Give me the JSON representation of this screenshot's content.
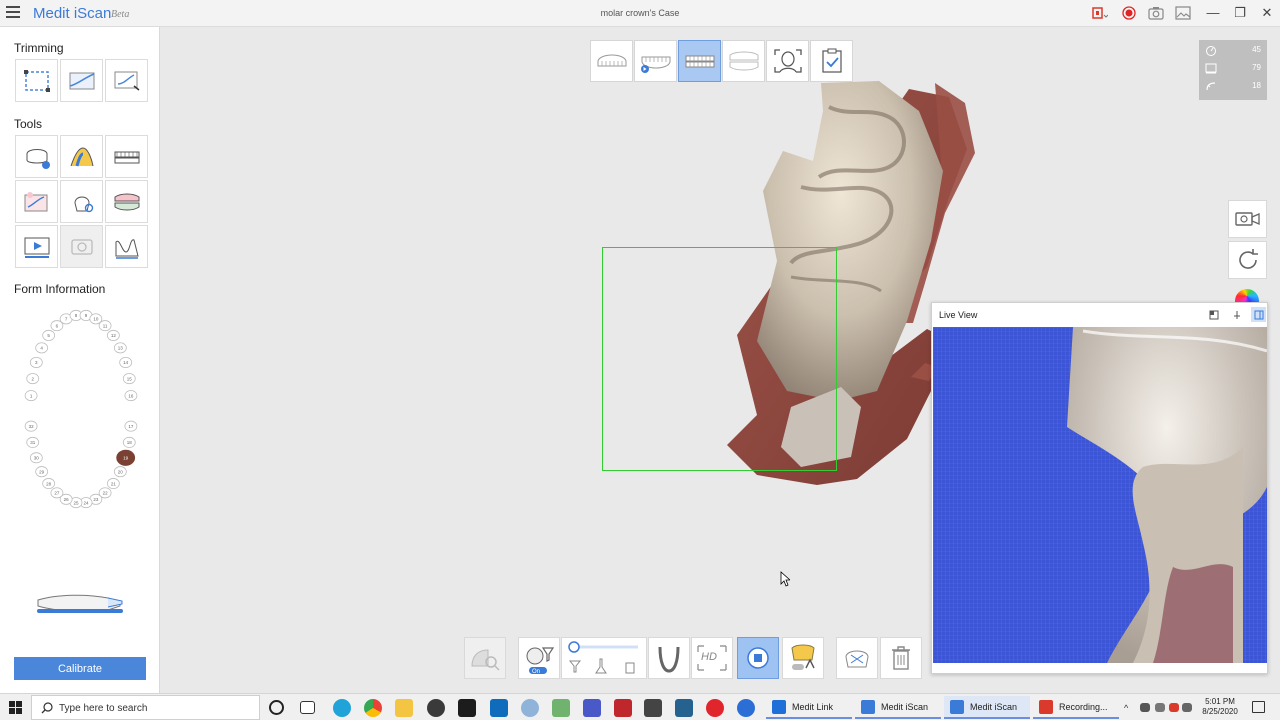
{
  "app": {
    "brand": "Medit iScan",
    "brand_suffix": "Beta",
    "window_title": "molar crown's Case",
    "colors": {
      "accent": "#3b7bd8",
      "scan_box": "#33cc33",
      "recording": "#e02424"
    }
  },
  "titlebar_icons": [
    "screen-record-menu-icon",
    "record-icon",
    "camera-icon",
    "image-icon",
    "minimize-icon",
    "maximize-icon",
    "close-icon"
  ],
  "leftpanel": {
    "trimming_title": "Trimming",
    "tools_title": "Tools",
    "form_title": "Form Information",
    "calibrate_label": "Calibrate",
    "trimming_tools": [
      "select-area-icon",
      "trim-plane-icon",
      "lasso-trim-icon"
    ],
    "tools": [
      "tooth-analysis-icon",
      "color-analysis-icon",
      "occlusion-icon",
      "compare-icon",
      "shade-tool-icon",
      "bite-icon",
      "playback-icon",
      "capture-icon",
      "ruler-icon"
    ],
    "teeth_upper": [
      "1",
      "2",
      "3",
      "4",
      "5",
      "6",
      "7",
      "8",
      "9",
      "10",
      "11",
      "12",
      "13",
      "14",
      "15",
      "16"
    ],
    "teeth_lower": [
      "17",
      "18",
      "19",
      "20",
      "21",
      "22",
      "23",
      "24",
      "25",
      "26",
      "27",
      "28",
      "29",
      "30",
      "31",
      "32"
    ],
    "selected_tooth": "19",
    "scan_depth_fraction": 0.5
  },
  "viewport": {
    "stages": [
      "maxilla-stage-icon",
      "mandible-stage-icon",
      "occlusion-stage-icon",
      "pre-op-stage-icon",
      "face-scan-icon",
      "checklist-icon"
    ],
    "active_stage_index": 2,
    "stats": [
      {
        "icon": "frame-rate-icon",
        "value": "45"
      },
      {
        "icon": "data-size-icon",
        "value": "79"
      },
      {
        "icon": "stitch-icon",
        "value": "18"
      }
    ],
    "side_buttons": [
      "video-camera-icon",
      "rotate-reset-icon",
      "color-wheel-icon"
    ],
    "bottom_tools": [
      "scan-region-icon",
      "filter-toggle-icon",
      "filter-slider-icon",
      "arch-icon",
      "hd-mode-icon",
      "stop-scan-icon",
      "ai-filter-icon",
      "snapshot-icon",
      "delete-icon"
    ],
    "toggle_on_label": "On"
  },
  "liveview": {
    "title": "Live View",
    "controls": [
      "popout-icon",
      "pin-icon",
      "panel-layout-icon"
    ]
  },
  "taskbar": {
    "search_placeholder": "Type here to search",
    "apps": [
      {
        "label": "Medit Link",
        "color": "#1f6fd8"
      },
      {
        "label": "Medit iScan",
        "color": "#3b7bd8"
      },
      {
        "label": "Medit iScan",
        "color": "#3b7bd8"
      },
      {
        "label": "Recording...",
        "color": "#d93a2b"
      }
    ],
    "time": "5:01 PM",
    "date": "8/25/2020"
  }
}
